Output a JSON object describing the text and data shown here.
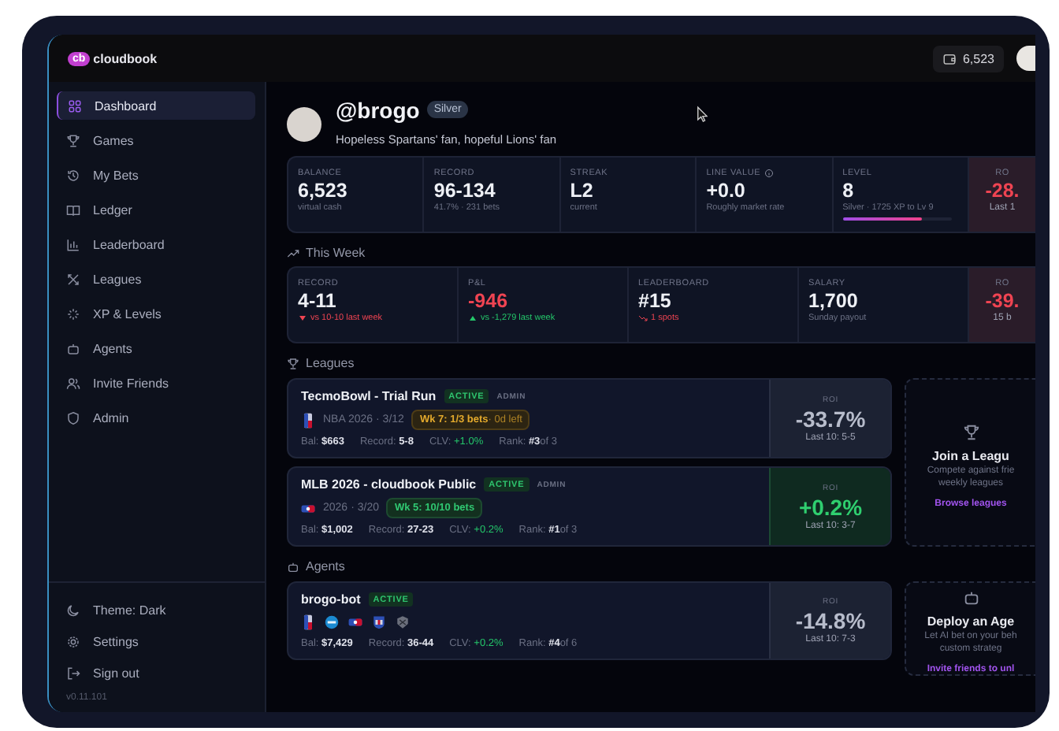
{
  "topbar": {
    "logo_mark": "cb",
    "logo_text": "cloudbook",
    "balance": "6,523"
  },
  "sidebar": {
    "items": [
      {
        "label": "Dashboard",
        "selected": true
      },
      {
        "label": "Games",
        "selected": false
      },
      {
        "label": "My Bets",
        "selected": false
      },
      {
        "label": "Ledger",
        "selected": false
      },
      {
        "label": "Leaderboard",
        "selected": false
      },
      {
        "label": "Leagues",
        "selected": false
      },
      {
        "label": "XP & Levels",
        "selected": false
      },
      {
        "label": "Agents",
        "selected": false
      },
      {
        "label": "Invite Friends",
        "selected": false
      },
      {
        "label": "Admin",
        "selected": false
      }
    ],
    "footer_items": [
      {
        "label": "Theme: Dark"
      },
      {
        "label": "Settings"
      },
      {
        "label": "Sign out"
      }
    ],
    "version": "v0.11.101"
  },
  "profile": {
    "handle": "@brogo",
    "tier": "Silver",
    "bio": "Hopeless Spartans' fan, hopeful Lions' fan"
  },
  "stats": [
    {
      "kind": "stat",
      "label": "BALANCE",
      "value": "6,523",
      "note": "virtual cash",
      "negative": false
    },
    {
      "kind": "stat",
      "label": "RECORD",
      "value": "96-134",
      "note": "41.7% · 231 bets",
      "negative": false
    },
    {
      "kind": "stat",
      "label": "STREAK",
      "value": "L2",
      "note": "current",
      "negative": false
    },
    {
      "kind": "stat",
      "label": "LINE VALUE",
      "value": "+0.0",
      "note": "Roughly market rate",
      "negative": false,
      "info": true
    },
    {
      "kind": "level",
      "label": "LEVEL",
      "value": "8",
      "note": "Silver · 1725 XP to Lv 9",
      "negative": false,
      "level": 0.73
    },
    {
      "kind": "roi",
      "label": "RO",
      "value": "-28.",
      "note": "Last 1",
      "negative": true
    }
  ],
  "this_week": {
    "title": "This Week",
    "stats": [
      {
        "kind": "stat",
        "label": "RECORD",
        "value": "4-11",
        "note": "vs 10-10 last week",
        "negative": false,
        "worse": true
      },
      {
        "kind": "stat",
        "label": "P&L",
        "value": "-946",
        "note": "vs -1,279 last week",
        "negative": true,
        "better": true
      },
      {
        "kind": "stat",
        "label": "LEADERBOARD",
        "value": "#15",
        "note": "1 spots",
        "negative": false,
        "rank_down": true
      },
      {
        "kind": "stat",
        "label": "SALARY",
        "value": "1,700",
        "note": "Sunday payout",
        "negative": false
      },
      {
        "kind": "roi",
        "label": "RO",
        "value": "-39.",
        "note": "15 b",
        "negative": true
      }
    ]
  },
  "leagues": {
    "title": "Leagues",
    "items": [
      {
        "name": "TecmoBowl - Trial Run",
        "status": "ACTIVE",
        "role": "ADMIN",
        "season": "NBA 2026",
        "date": "· 3/12",
        "week": "Wk 7: 1/3 bets",
        "week_extra": "· 0d left",
        "complete": false,
        "stats": [
          {
            "label": "Bal:",
            "value": "$663",
            "positive": false
          },
          {
            "label": "Record:",
            "value": "5-8",
            "positive": false
          },
          {
            "label": "CLV:",
            "value": "+1.0%",
            "positive": true
          },
          {
            "label": "Rank:",
            "value": "#3",
            "suffix": "of 3",
            "positive": false
          }
        ],
        "roi_label": "ROI",
        "roi": "-33.7%",
        "positive": false,
        "last10": "Last 10: 5-5"
      },
      {
        "name": "MLB 2026 - cloudbook Public",
        "status": "ACTIVE",
        "role": "ADMIN",
        "season": "2026",
        "date": "· 3/20",
        "week": "Wk 5: 10/10 bets",
        "complete": true,
        "stats": [
          {
            "label": "Bal:",
            "value": "$1,002",
            "positive": false
          },
          {
            "label": "Record:",
            "value": "27-23",
            "positive": false
          },
          {
            "label": "CLV:",
            "value": "+0.2%",
            "positive": true
          },
          {
            "label": "Rank:",
            "value": "#1",
            "suffix": "of 3",
            "positive": false
          }
        ],
        "roi_label": "ROI",
        "roi": "+0.2%",
        "positive": true,
        "last10": "Last 10: 3-7"
      }
    ],
    "side_card": {
      "title": "Join a Leagu",
      "lines": [
        "Compete against frie",
        "weekly leagues"
      ],
      "link": "Browse leagues"
    }
  },
  "agents": {
    "title": "Agents",
    "items": [
      {
        "name": "brogo-bot",
        "status": "ACTIVE",
        "stats": [
          {
            "label": "Bal:",
            "value": "$7,429",
            "positive": false
          },
          {
            "label": "Record:",
            "value": "36-44",
            "positive": false
          },
          {
            "label": "CLV:",
            "value": "+0.2%",
            "positive": true
          },
          {
            "label": "Rank:",
            "value": "#4",
            "suffix": "of 6",
            "positive": false
          }
        ],
        "roi_label": "ROI",
        "roi": "-14.8%",
        "positive": false,
        "last10": "Last 10: 7-3"
      }
    ],
    "side_card": {
      "title": "Deploy an Age",
      "lines": [
        "Let AI bet on your beh",
        "custom strateg"
      ],
      "link": "Invite friends to unl"
    }
  }
}
